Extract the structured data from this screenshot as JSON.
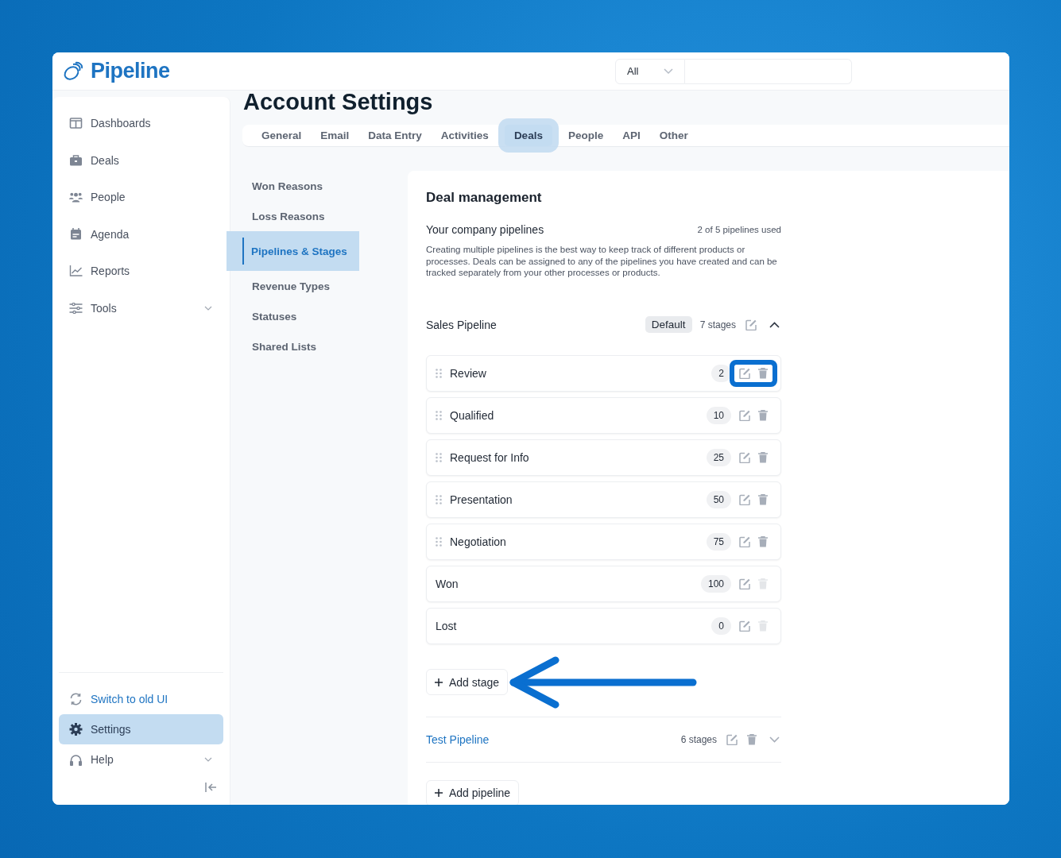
{
  "header": {
    "logo": "Pipeline",
    "search_scope": "All"
  },
  "sidebar": {
    "items": [
      {
        "label": "Dashboards",
        "expandable": false
      },
      {
        "label": "Deals",
        "expandable": false
      },
      {
        "label": "People",
        "expandable": false
      },
      {
        "label": "Agenda",
        "expandable": false
      },
      {
        "label": "Reports",
        "expandable": false
      },
      {
        "label": "Tools",
        "expandable": true
      }
    ],
    "bottom_items": [
      {
        "label": "Switch to old UI",
        "kind": "link",
        "selected": false,
        "expandable": false
      },
      {
        "label": "Settings",
        "kind": "item",
        "selected": true,
        "expandable": false
      },
      {
        "label": "Help",
        "kind": "item",
        "selected": false,
        "expandable": true
      }
    ]
  },
  "page_title": "Account Settings",
  "tabs": [
    {
      "label": "General",
      "selected": false
    },
    {
      "label": "Email",
      "selected": false
    },
    {
      "label": "Data Entry",
      "selected": false
    },
    {
      "label": "Activities",
      "selected": false
    },
    {
      "label": "Deals",
      "selected": true
    },
    {
      "label": "People",
      "selected": false
    },
    {
      "label": "API",
      "selected": false
    },
    {
      "label": "Other",
      "selected": false
    }
  ],
  "subnav": [
    {
      "label": "Won Reasons",
      "selected": false
    },
    {
      "label": "Loss Reasons",
      "selected": false
    },
    {
      "label": "Pipelines & Stages",
      "selected": true
    },
    {
      "label": "Revenue Types",
      "selected": false
    },
    {
      "label": "Statuses",
      "selected": false
    },
    {
      "label": "Shared Lists",
      "selected": false
    }
  ],
  "deal_management": {
    "title": "Deal management",
    "subtitle": "Your company pipelines",
    "usage": "2 of 5 pipelines used",
    "description": "Creating multiple pipelines is the best way to keep track of different products or processes. Deals can be assigned to any of the pipelines you have created and can be tracked separately from your other processes or products.",
    "pipelines": [
      {
        "name": "Sales Pipeline",
        "badge": "Default",
        "stage_count": "7 stages",
        "expanded": true,
        "deletable": false,
        "stages": [
          {
            "name": "Review",
            "value": "2",
            "draggable": true,
            "deletable": true
          },
          {
            "name": "Qualified",
            "value": "10",
            "draggable": true,
            "deletable": true
          },
          {
            "name": "Request for Info",
            "value": "25",
            "draggable": true,
            "deletable": true
          },
          {
            "name": "Presentation",
            "value": "50",
            "draggable": true,
            "deletable": true
          },
          {
            "name": "Negotiation",
            "value": "75",
            "draggable": true,
            "deletable": true
          },
          {
            "name": "Won",
            "value": "100",
            "draggable": false,
            "deletable": false
          },
          {
            "name": "Lost",
            "value": "0",
            "draggable": false,
            "deletable": false
          }
        ],
        "add_stage": "Add stage"
      },
      {
        "name": "Test Pipeline",
        "stage_count": "6 stages",
        "expanded": false,
        "deletable": true
      }
    ],
    "add_pipeline": "Add pipeline"
  }
}
